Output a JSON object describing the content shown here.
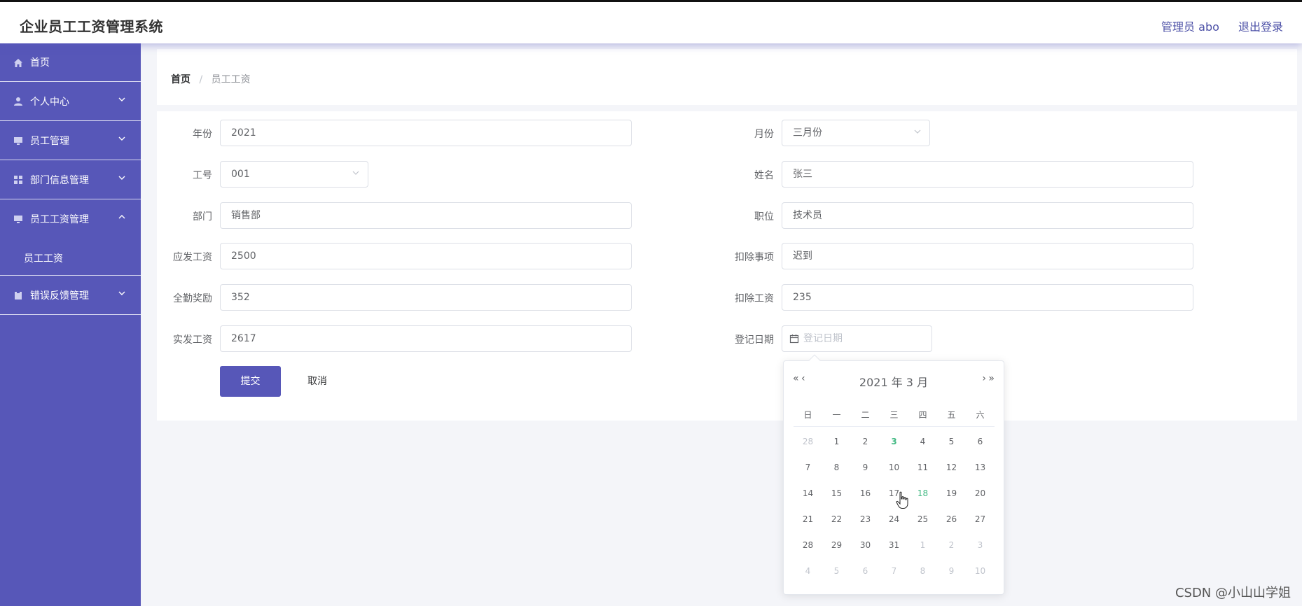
{
  "header": {
    "title": "企业员工工资管理系统",
    "user": "管理员 abo",
    "logout": "退出登录"
  },
  "sidebar": {
    "items": [
      {
        "label": "首页"
      },
      {
        "label": "个人中心"
      },
      {
        "label": "员工管理"
      },
      {
        "label": "部门信息管理"
      },
      {
        "label": "员工工资管理"
      },
      {
        "label": "员工工资"
      },
      {
        "label": "错误反馈管理"
      }
    ]
  },
  "breadcrumb": {
    "home": "首页",
    "sep": "/",
    "current": "员工工资"
  },
  "form": {
    "year_label": "年份",
    "year_value": "2021",
    "month_label": "月份",
    "month_value": "三月份",
    "empno_label": "工号",
    "empno_value": "001",
    "name_label": "姓名",
    "name_value": "张三",
    "dept_label": "部门",
    "dept_value": "销售部",
    "position_label": "职位",
    "position_value": "技术员",
    "gross_label": "应发工资",
    "gross_value": "2500",
    "deduct_item_label": "扣除事项",
    "deduct_item_value": "迟到",
    "bonus_label": "全勤奖励",
    "bonus_value": "352",
    "deduct_amount_label": "扣除工资",
    "deduct_amount_value": "235",
    "net_label": "实发工资",
    "net_value": "2617",
    "date_label": "登记日期",
    "date_placeholder": "登记日期",
    "submit": "提交",
    "cancel": "取消"
  },
  "datepicker": {
    "prev_year": "«",
    "prev_month": "‹",
    "next_month": "›",
    "next_year": "»",
    "title": "2021 年  3 月",
    "weekdays": [
      "日",
      "一",
      "二",
      "三",
      "四",
      "五",
      "六"
    ],
    "weeks": [
      [
        "28",
        "1",
        "2",
        "3",
        "4",
        "5",
        "6"
      ],
      [
        "7",
        "8",
        "9",
        "10",
        "11",
        "12",
        "13"
      ],
      [
        "14",
        "15",
        "16",
        "17",
        "18",
        "19",
        "20"
      ],
      [
        "21",
        "22",
        "23",
        "24",
        "25",
        "26",
        "27"
      ],
      [
        "28",
        "29",
        "30",
        "31",
        "1",
        "2",
        "3"
      ],
      [
        "4",
        "5",
        "6",
        "7",
        "8",
        "9",
        "10"
      ]
    ]
  },
  "watermark": "CSDN @小山山学姐"
}
